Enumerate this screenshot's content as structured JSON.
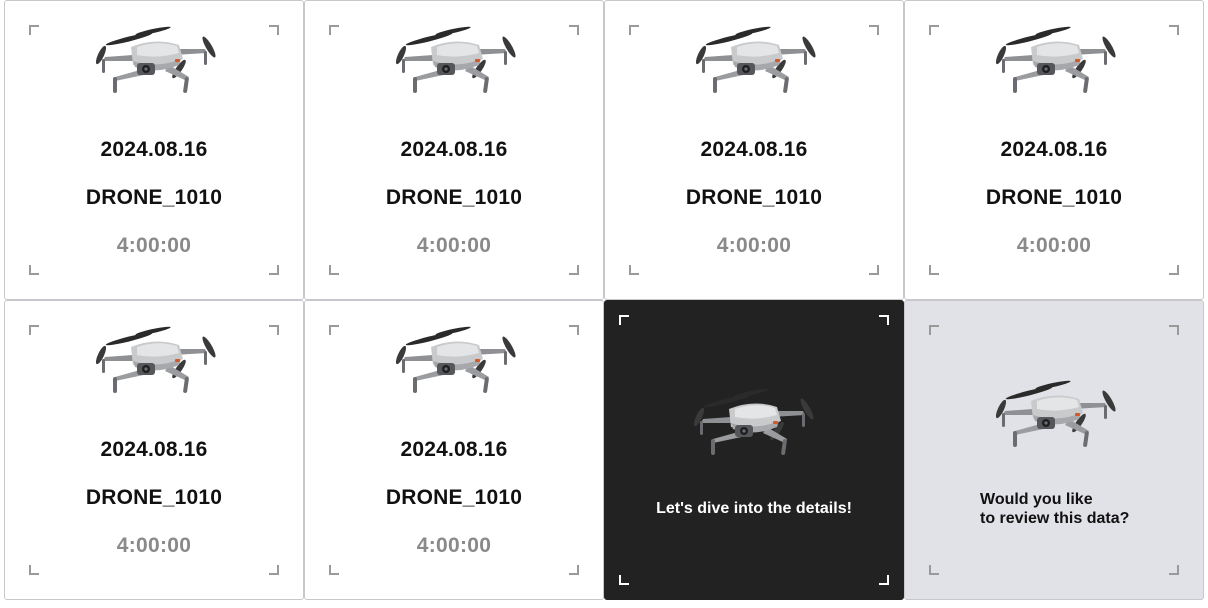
{
  "cards": [
    {
      "date": "2024.08.16",
      "name": "DRONE_1010",
      "duration": "4:00:00"
    },
    {
      "date": "2024.08.16",
      "name": "DRONE_1010",
      "duration": "4:00:00"
    },
    {
      "date": "2024.08.16",
      "name": "DRONE_1010",
      "duration": "4:00:00"
    },
    {
      "date": "2024.08.16",
      "name": "DRONE_1010",
      "duration": "4:00:00"
    },
    {
      "date": "2024.08.16",
      "name": "DRONE_1010",
      "duration": "4:00:00"
    },
    {
      "date": "2024.08.16",
      "name": "DRONE_1010",
      "duration": "4:00:00"
    }
  ],
  "promo_card": {
    "text": "Let's dive into the details!"
  },
  "review_card": {
    "line1": "Would you like",
    "line2": "to review this data?"
  },
  "colors": {
    "dark_card": "#232223",
    "muted_card": "#e1e1e8",
    "duration_text": "#8a8a8a"
  },
  "icons": {
    "drone": "drone-icon"
  }
}
